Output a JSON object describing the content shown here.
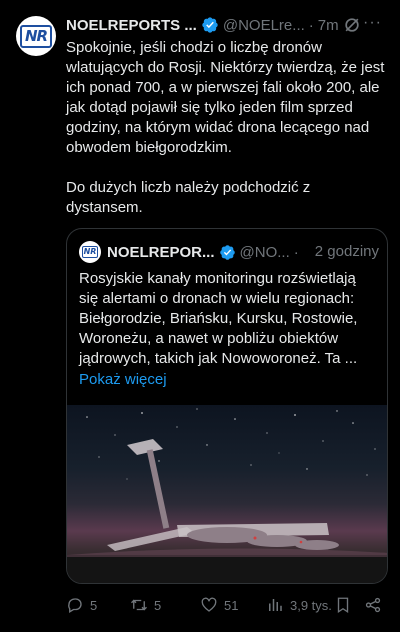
{
  "tweet": {
    "name": "NOELREPORTS ...",
    "handle": "@NOELre...",
    "separator": "·",
    "time": "7m",
    "more": "···",
    "text": "Spokojnie, jeśli chodzi o liczbę dronów wlatujących do Rosji. Niektórzy twierdzą, że jest ich ponad 700, a w pierwszej fali około 200, ale jak dotąd pojawił się tylko jeden film sprzed godziny, na którym widać drona lecącego nad obwodem biełgorodzkim.\n\nDo dużych liczb należy podchodzić z dystansem."
  },
  "quote": {
    "name": "NOELREPOR...",
    "handle": "@NO...",
    "separator": "·",
    "time": "2 godziny",
    "text": "Rosyjskie kanały monitoringu rozświetlają się alertami o dronach w wielu regionach: Biełgorodzie, Briańsku, Kursku, Rostowie, Woroneżu, a nawet w pobliżu obiektów jądrowych, takich jak Nowoworoneż. Ta ...",
    "show_more": "Pokaż więcej"
  },
  "avatar_text": "NR",
  "actions": {
    "replies": "5",
    "reposts": "5",
    "likes": "51",
    "views": "3,9 tys."
  },
  "colors": {
    "background": "#000000",
    "text": "#e7e9ea",
    "muted": "#71767b",
    "link": "#1d9bf0",
    "verified": "#1d9bf0"
  }
}
